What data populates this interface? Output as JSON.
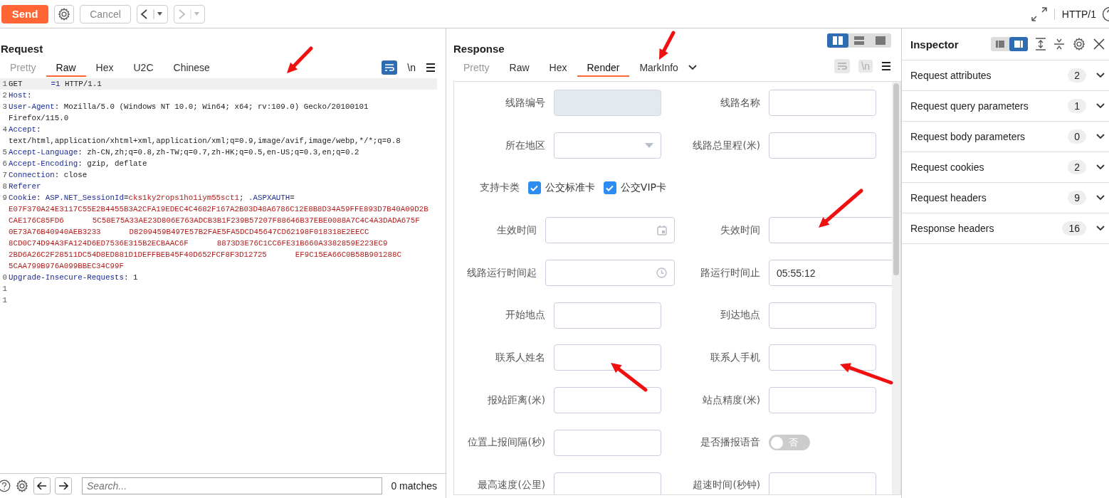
{
  "toolbar": {
    "send": "Send",
    "cancel": "Cancel",
    "protocol": "HTTP/1"
  },
  "request": {
    "title": "Request",
    "tabs": [
      {
        "label": "Pretty",
        "selected": false
      },
      {
        "label": "Raw",
        "selected": true
      },
      {
        "label": "Hex",
        "selected": false
      },
      {
        "label": "U2C",
        "selected": false
      },
      {
        "label": "Chinese",
        "selected": false
      }
    ],
    "wrap_on": true,
    "newline_label": "\\n",
    "lines": [
      {
        "number": "1",
        "highlight": true,
        "segments": [
          {
            "kind": "plain",
            "text": "GET"
          },
          {
            "kind": "gap"
          },
          {
            "kind": "param",
            "text": "=1"
          },
          {
            "kind": "plain",
            "text": " HTTP/1.1"
          }
        ]
      },
      {
        "number": "2",
        "highlight": false,
        "segments": [
          {
            "kind": "name",
            "text": "Host"
          },
          {
            "kind": "plain",
            "text": ":"
          }
        ]
      },
      {
        "number": "3",
        "highlight": false,
        "segments": [
          {
            "kind": "name",
            "text": "User-Agent"
          },
          {
            "kind": "plain",
            "text": ": Mozilla/5.0 (Windows NT 10.0; Win64; x64; rv:109.0) Gecko/20100101"
          }
        ]
      },
      {
        "highlight": false,
        "segments": [
          {
            "kind": "plain",
            "text": "Firefox/115.0"
          }
        ]
      },
      {
        "number": "4",
        "highlight": false,
        "segments": [
          {
            "kind": "name",
            "text": "Accept"
          },
          {
            "kind": "plain",
            "text": ":"
          }
        ]
      },
      {
        "highlight": false,
        "segments": [
          {
            "kind": "plain",
            "text": "text/html,application/xhtml+xml,application/xml;q=0.9,image/avif,image/webp,*/*;q=0.8"
          }
        ]
      },
      {
        "number": "5",
        "highlight": false,
        "segments": [
          {
            "kind": "name",
            "text": "Accept-Language"
          },
          {
            "kind": "plain",
            "text": ": zh-CN,zh;q=0.8,zh-TW;q=0.7,zh-HK;q=0.5,en-US;q=0.3,en;q=0.2"
          }
        ]
      },
      {
        "number": "6",
        "highlight": false,
        "segments": [
          {
            "kind": "name",
            "text": "Accept-Encoding"
          },
          {
            "kind": "plain",
            "text": ": gzip, deflate"
          }
        ]
      },
      {
        "number": "7",
        "highlight": false,
        "segments": [
          {
            "kind": "name",
            "text": "Connection"
          },
          {
            "kind": "plain",
            "text": ": close"
          }
        ]
      },
      {
        "number": "8",
        "highlight": false,
        "segments": [
          {
            "kind": "name",
            "text": "Referer"
          }
        ]
      },
      {
        "number": "9",
        "highlight": false,
        "segments": [
          {
            "kind": "name",
            "text": "Cookie"
          },
          {
            "kind": "plain",
            "text": ": "
          },
          {
            "kind": "name",
            "text": "ASP.NET_SessionId"
          },
          {
            "kind": "plain",
            "text": "="
          },
          {
            "kind": "value",
            "text": "cks1ky2rops1ho1iym55sct1"
          },
          {
            "kind": "plain",
            "text": "; "
          },
          {
            "kind": "name",
            "text": ".ASPXAUTH"
          },
          {
            "kind": "plain",
            "text": "="
          }
        ]
      },
      {
        "highlight": false,
        "segments": [
          {
            "kind": "value",
            "text": "E07F370A24E3117C55E2B4455B3A2CFA19EDEC4C4682F167A2B03D48A6786C12E8B8D34A59FFE893D7B40A09D2B"
          }
        ]
      },
      {
        "highlight": false,
        "segments": [
          {
            "kind": "value",
            "text": "CAE176C85FD6"
          },
          {
            "kind": "gap"
          },
          {
            "kind": "value",
            "text": "5C58E75A33AE23D806E763ADCB3B1F239B57207F88646B37EBE0088A7C4C4A3DADA675F"
          }
        ]
      },
      {
        "highlight": false,
        "segments": [
          {
            "kind": "value",
            "text": "0E73A76B40940AEB3233"
          },
          {
            "kind": "gap"
          },
          {
            "kind": "value",
            "text": "D8209459B497E57B2FAE5FA5DCD45647CD62198F018318E2EECC"
          }
        ]
      },
      {
        "highlight": false,
        "segments": [
          {
            "kind": "value",
            "text": "8CD0C74D94A3FA124D6ED7536E315B2ECBAAC6F"
          },
          {
            "kind": "gap"
          },
          {
            "kind": "value",
            "text": "8873D3E76C1CC6FE31B660A3382859E223EC9"
          }
        ]
      },
      {
        "highlight": false,
        "segments": [
          {
            "kind": "value",
            "text": "2BD6A26C2F28511DC54D8ED881D1DEFFBEB45F40D652FCF8F3D12725"
          },
          {
            "kind": "gap"
          },
          {
            "kind": "value",
            "text": "EF9C15EA66C0B58B901288C"
          }
        ]
      },
      {
        "highlight": false,
        "segments": [
          {
            "kind": "value",
            "text": "5CAA799B976A099BBEC34C99F"
          }
        ]
      },
      {
        "number": "0",
        "highlight": false,
        "segments": [
          {
            "kind": "name",
            "text": "Upgrade-Insecure-Requests"
          },
          {
            "kind": "plain",
            "text": ": 1"
          }
        ]
      },
      {
        "number": "1",
        "highlight": false
      },
      {
        "number": "1",
        "highlight": false
      }
    ],
    "search": {
      "placeholder": "Search...",
      "matches": "0 matches"
    }
  },
  "response": {
    "title": "Response",
    "tabs": [
      {
        "label": "Pretty",
        "selected": false
      },
      {
        "label": "Raw",
        "selected": false
      },
      {
        "label": "Hex",
        "selected": false
      },
      {
        "label": "Render",
        "selected": true
      },
      {
        "label": "MarkInfo",
        "selected": false
      }
    ],
    "wrap_on": false,
    "newline_label": "\\n",
    "form": [
      [
        {
          "label": "线路编号",
          "kind": "text",
          "disabled": true
        },
        {
          "label": "线路名称",
          "kind": "text",
          "disabled": false
        }
      ],
      [
        {
          "label": "所在地区",
          "kind": "select",
          "disabled": false
        },
        {
          "label": "线路总里程(米)",
          "kind": "text",
          "disabled": false
        }
      ],
      [
        {
          "label": "支持卡类",
          "kind": "checkboxes",
          "options": [
            {
              "label": "公交标准卡",
              "checked": true
            },
            {
              "label": "公交VIP卡",
              "checked": true
            }
          ]
        }
      ],
      [
        {
          "label": "生效时间",
          "kind": "date",
          "disabled": false
        },
        {
          "label": "失效时间",
          "kind": "wide",
          "disabled": false
        }
      ],
      [
        {
          "label": "线路运行时间起",
          "kind": "time",
          "disabled": false
        },
        {
          "label": "路运行时间止",
          "kind": "wide",
          "disabled": false,
          "value": "05:55:12"
        }
      ],
      [
        {
          "label": "开始地点",
          "kind": "text",
          "disabled": false
        },
        {
          "label": "到达地点",
          "kind": "text",
          "disabled": false
        }
      ],
      [
        {
          "label": "联系人姓名",
          "kind": "text",
          "disabled": false
        },
        {
          "label": "联系人手机",
          "kind": "text",
          "disabled": false
        }
      ],
      [
        {
          "label": "报站距离(米)",
          "kind": "text",
          "disabled": false
        },
        {
          "label": "站点精度(米)",
          "kind": "text",
          "disabled": false
        }
      ],
      [
        {
          "label": "位置上报间隔(秒)",
          "kind": "text",
          "disabled": false
        },
        {
          "label": "是否播报语音",
          "kind": "toggle",
          "on": false,
          "text": "否"
        }
      ],
      [
        {
          "label": "最高速度(公里)",
          "kind": "text",
          "disabled": false
        },
        {
          "label": "超速时间(秒钟)",
          "kind": "text",
          "disabled": false
        }
      ]
    ]
  },
  "inspector": {
    "title": "Inspector",
    "sections": [
      {
        "label": "Request attributes",
        "count": "2"
      },
      {
        "label": "Request query parameters",
        "count": "1"
      },
      {
        "label": "Request body parameters",
        "count": "0"
      },
      {
        "label": "Request cookies",
        "count": "2"
      },
      {
        "label": "Request headers",
        "count": "9"
      },
      {
        "label": "Response headers",
        "count": "16"
      }
    ]
  }
}
